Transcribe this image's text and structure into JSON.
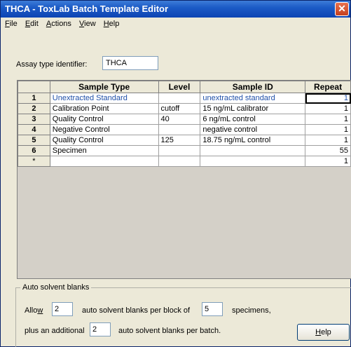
{
  "window": {
    "title": "THCA - ToxLab Batch Template Editor",
    "close_glyph": "✕"
  },
  "menu": {
    "items": [
      {
        "label": "File",
        "mnemonic": "F"
      },
      {
        "label": "Edit",
        "mnemonic": "E"
      },
      {
        "label": "Actions",
        "mnemonic": "A"
      },
      {
        "label": "View",
        "mnemonic": "V"
      },
      {
        "label": "Help",
        "mnemonic": "H"
      }
    ]
  },
  "assay": {
    "label": "Assay type identifier:",
    "value": "THCA"
  },
  "grid": {
    "columns": [
      "Sample Type",
      "Level",
      "Sample ID",
      "Repeat"
    ],
    "rows": [
      {
        "num": "1",
        "sample_type": "Unextracted Standard",
        "level": "",
        "sample_id": "unextracted standard",
        "repeat": "1"
      },
      {
        "num": "2",
        "sample_type": "Calibration Point",
        "level": "cutoff",
        "sample_id": "15 ng/mL calibrator",
        "repeat": "1"
      },
      {
        "num": "3",
        "sample_type": "Quality Control",
        "level": "40",
        "sample_id": "6 ng/mL control",
        "repeat": "1"
      },
      {
        "num": "4",
        "sample_type": "Negative Control",
        "level": "",
        "sample_id": "negative control",
        "repeat": "1"
      },
      {
        "num": "5",
        "sample_type": "Quality Control",
        "level": "125",
        "sample_id": "18.75 ng/mL control",
        "repeat": "1"
      },
      {
        "num": "6",
        "sample_type": "Specimen",
        "level": "",
        "sample_id": "",
        "repeat": "55"
      },
      {
        "num": "*",
        "sample_type": "",
        "level": "",
        "sample_id": "",
        "repeat": "1"
      }
    ]
  },
  "solvent_blanks": {
    "group_title": "Auto solvent blanks",
    "allow_label": "Allow",
    "per_block_value": "2",
    "per_block_label": "auto solvent blanks per block of",
    "block_size_value": "5",
    "specimens_label": "specimens,",
    "plus_label": "plus an additional",
    "per_batch_value": "2",
    "per_batch_label": "auto solvent blanks per batch."
  },
  "buttons": {
    "help": "Help"
  }
}
